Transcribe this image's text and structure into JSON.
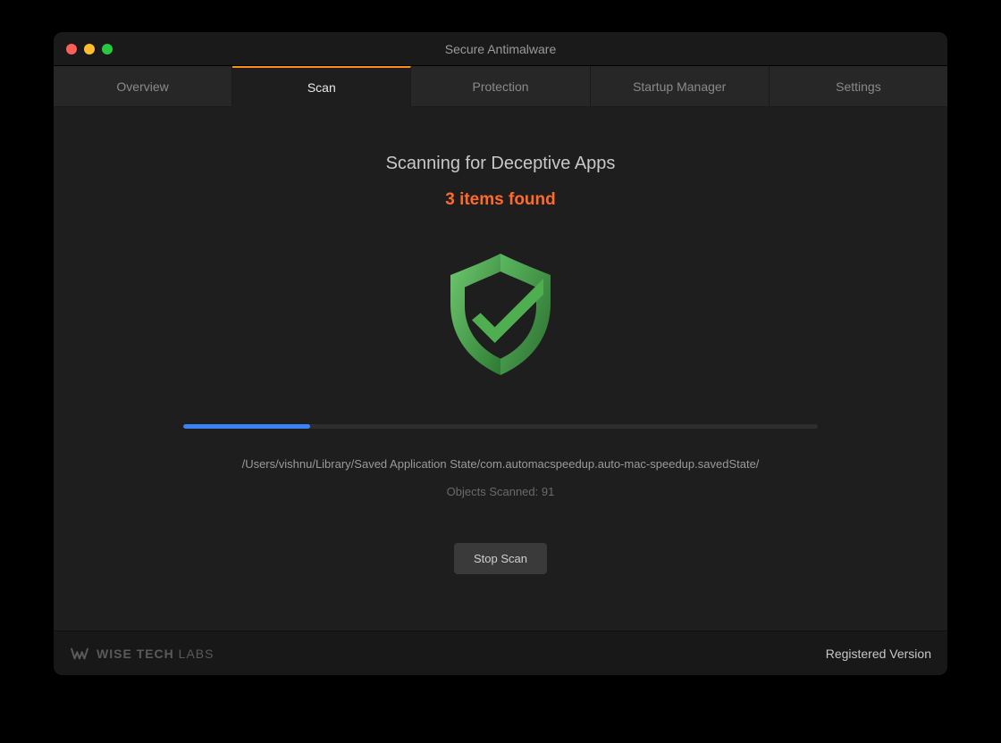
{
  "window": {
    "title": "Secure Antimalware"
  },
  "tabs": [
    {
      "label": "Overview",
      "active": false
    },
    {
      "label": "Scan",
      "active": true
    },
    {
      "label": "Protection",
      "active": false
    },
    {
      "label": "Startup Manager",
      "active": false
    },
    {
      "label": "Settings",
      "active": false
    }
  ],
  "scan": {
    "heading": "Scanning for Deceptive Apps",
    "items_found_label": "3 items found",
    "items_found_count": 3,
    "progress_percent": 20,
    "current_path": "/Users/vishnu/Library/Saved Application State/com.automacspeedup.auto-mac-speedup.savedState/",
    "objects_scanned_label": "Objects Scanned: 91",
    "objects_scanned_count": 91,
    "stop_button_label": "Stop Scan"
  },
  "footer": {
    "brand_strong": "WISE TECH",
    "brand_light": " LABS",
    "version_label": "Registered Version"
  },
  "colors": {
    "accent_orange": "#ff8c1a",
    "alert_orange": "#ff6a2b",
    "progress_blue": "#3b82f6",
    "shield_green_dark": "#2d7a33",
    "shield_green_light": "#5cb860"
  }
}
